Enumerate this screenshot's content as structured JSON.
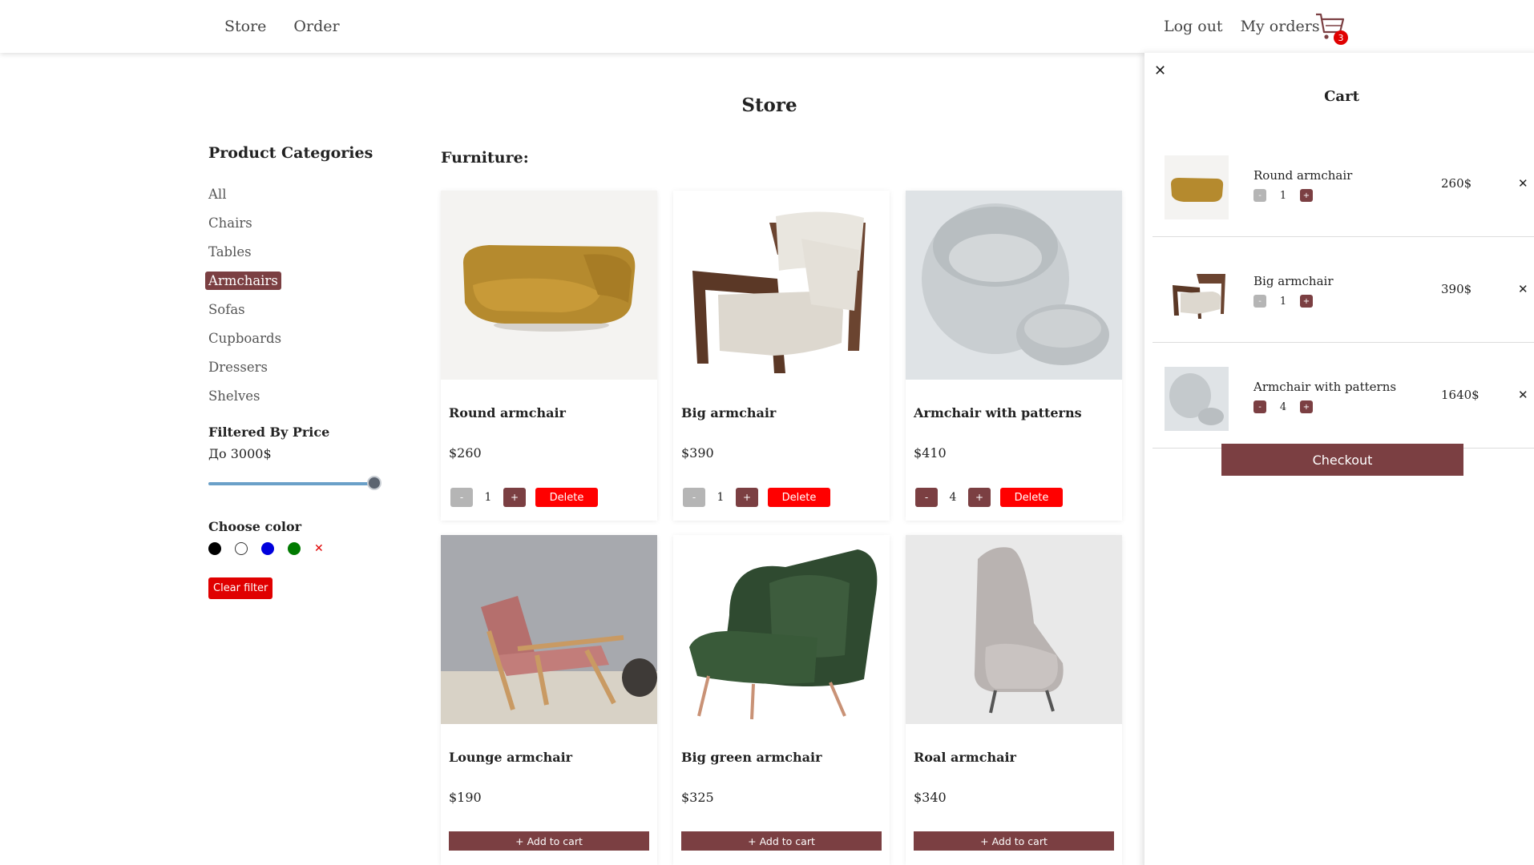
{
  "nav": {
    "store": "Store",
    "order": "Order",
    "logout": "Log out",
    "my_orders": "My orders",
    "cart_count": "3"
  },
  "page_title": "Store",
  "sidebar": {
    "heading": "Product Categories",
    "categories": [
      "All",
      "Chairs",
      "Tables",
      "Armchairs",
      "Sofas",
      "Cupboards",
      "Dressers",
      "Shelves"
    ],
    "active_category": "Armchairs",
    "price_heading": "Filtered By Price",
    "price_label": "До 3000$",
    "price_max_fraction": 1.0,
    "color_heading": "Choose color",
    "colors": [
      "#000000",
      "#ffffff",
      "#0000dd",
      "#007a00"
    ],
    "color_clear": "✕",
    "clear_filter": "Clear filter"
  },
  "section_title": "Furniture:",
  "products": [
    {
      "name": "Round armchair",
      "price": "$260",
      "in_cart": true,
      "qty": "1",
      "delete": "Delete"
    },
    {
      "name": "Big armchair",
      "price": "$390",
      "in_cart": true,
      "qty": "1",
      "delete": "Delete"
    },
    {
      "name": "Armchair with patterns",
      "price": "$410",
      "in_cart": true,
      "qty": "4",
      "delete": "Delete"
    },
    {
      "name": "Lounge armchair",
      "price": "$190",
      "in_cart": false,
      "add": "+ Add to cart"
    },
    {
      "name": "Big green armchair",
      "price": "$325",
      "in_cart": false,
      "add": "+ Add to cart"
    },
    {
      "name": "Roal armchair",
      "price": "$340",
      "in_cart": false,
      "add": "+ Add to cart"
    }
  ],
  "cart": {
    "close": "✕",
    "title": "Cart",
    "items": [
      {
        "name": "Round armchair",
        "qty": "1",
        "price": "260$",
        "remove": "✕"
      },
      {
        "name": "Big armchair",
        "qty": "1",
        "price": "390$",
        "remove": "✕"
      },
      {
        "name": "Armchair with patterns",
        "qty": "4",
        "price": "1640$",
        "remove": "✕"
      }
    ],
    "checkout": "Checkout"
  },
  "symbols": {
    "minus": "-",
    "plus": "+"
  },
  "colors": {
    "accent": "#7b3f42",
    "danger": "#ff0000",
    "disabled": "#b5b5b5"
  }
}
